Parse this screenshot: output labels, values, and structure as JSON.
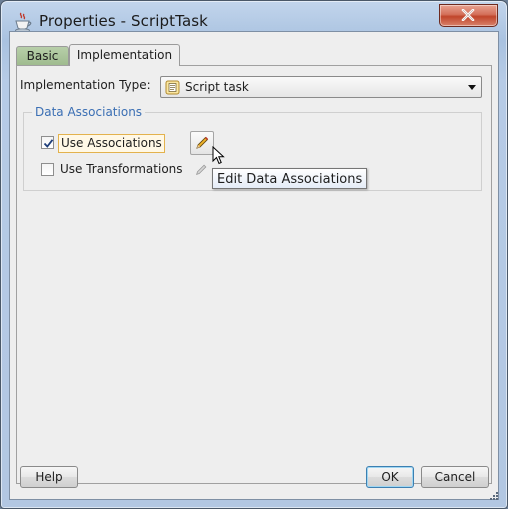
{
  "window": {
    "title": "Properties - ScriptTask",
    "app_icon": "java-cup-icon",
    "close_icon": "close-icon"
  },
  "tabs": [
    {
      "label": "Basic",
      "selected": false
    },
    {
      "label": "Implementation",
      "selected": true
    }
  ],
  "implementation": {
    "label": "Implementation Type:",
    "value": "Script task",
    "value_icon": "script-task-icon"
  },
  "data_associations": {
    "legend": "Data Associations",
    "use_associations": {
      "label": "Use Associations",
      "checked": true
    },
    "use_transformations": {
      "label": "Use Transformations",
      "checked": false
    },
    "edit_button_icon": "pencil-icon",
    "tooltip": "Edit Data Associations"
  },
  "footer": {
    "help_label": "Help",
    "ok_label": "OK",
    "cancel_label": "Cancel"
  },
  "colors": {
    "legend": "#3b6fb4",
    "focus_border": "#e3b24d",
    "close_button": "#c1452b"
  }
}
